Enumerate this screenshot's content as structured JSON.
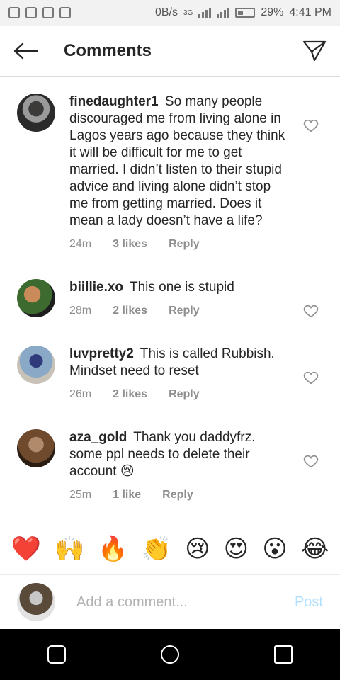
{
  "status": {
    "left_icons": [
      "whatsapp-icon",
      "gallery-icon",
      "lock-icon",
      "battery-saver-icon"
    ],
    "speed": "0B/s",
    "network": "3G",
    "battery": "29%",
    "time": "4:41 PM"
  },
  "header": {
    "title": "Comments",
    "back_icon": "back-arrow-icon",
    "send_icon": "send-icon"
  },
  "comments": [
    {
      "user": "finedaughter1",
      "text": "So many people discouraged me from living alone in Lagos years ago because they think it will be difficult for me to get married. I didn’t listen to their stupid advice and living alone didn’t stop me from getting married. Does it mean a lady doesn’t have a life?",
      "time": "24m",
      "likes": "3 likes",
      "reply": "Reply"
    },
    {
      "user": "biillie.xo",
      "text": "This one is stupid",
      "time": "28m",
      "likes": "2 likes",
      "reply": "Reply"
    },
    {
      "user": "luvpretty2",
      "text": "This is called Rubbish. Mindset need  to reset",
      "time": "26m",
      "likes": "2 likes",
      "reply": "Reply"
    },
    {
      "user": "aza_gold",
      "text": "Thank you daddyfrz. some ppl needs to delete their account 😢",
      "time": "25m",
      "likes": "1 like",
      "reply": "Reply"
    }
  ],
  "emoji_bar": [
    "❤️",
    "🙌",
    "🔥",
    "👏",
    "😢",
    "😍",
    "😮",
    "😂"
  ],
  "composer": {
    "placeholder": "Add a comment...",
    "post": "Post"
  }
}
